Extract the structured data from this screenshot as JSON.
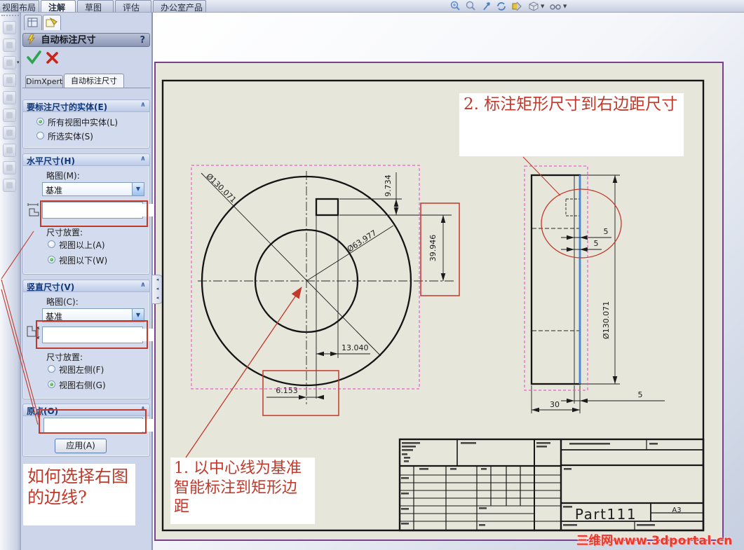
{
  "command_tabs": {
    "items": [
      {
        "label": "视图布局"
      },
      {
        "label": "注解"
      },
      {
        "label": "草图"
      },
      {
        "label": "评估"
      },
      {
        "label": "办公室产品"
      }
    ],
    "active": "注解"
  },
  "heads_up_icons": [
    {
      "name": "zoom-in-icon"
    },
    {
      "name": "zoom-area-icon"
    },
    {
      "name": "pan-icon"
    },
    {
      "name": "rotate-view-icon"
    },
    {
      "name": "section-view-icon"
    },
    {
      "name": "view-orientation-icon"
    },
    {
      "name": "eyeglasses-icon"
    }
  ],
  "property_manager": {
    "header": {
      "title": "自动标注尺寸",
      "help": "?"
    },
    "mode_tabs": {
      "dimxpert": "DimXpert",
      "autodim": "自动标注尺寸"
    },
    "entities_group": {
      "title": "要标注尺寸的实体(E)",
      "radio_all": "所有视图中实体(L)",
      "radio_selected": "所选实体(S)"
    },
    "horizontal_group": {
      "title": "水平尺寸(H)",
      "scheme_label": "略图(M):",
      "scheme_value": "基准",
      "placement_label": "尺寸放置:",
      "radio_above": "视图以上(A)",
      "radio_below": "视图以下(W)"
    },
    "vertical_group": {
      "title": "竖直尺寸(V)",
      "scheme_label": "略图(C):",
      "scheme_value": "基准",
      "placement_label": "尺寸放置:",
      "radio_left": "视图左侧(F)",
      "radio_right": "视图右侧(G)"
    },
    "origin_group": {
      "title": "原点(O)",
      "apply_label": "应用(A)"
    }
  },
  "notes": {
    "note1": "1. 以中心线为基准智能标注到矩形边距",
    "note2": "2. 标注矩形尺寸到右边距尺寸",
    "question": "如何选择右图的边线?"
  },
  "drawing": {
    "front_view": {
      "dia_outer": "Ø130.071",
      "dia_inner": "Ø63.977",
      "keyway_height": "9.734",
      "keyway_to_center": "39.946",
      "keyway_width": "13.040",
      "center_offset": "6.153"
    },
    "side_view": {
      "gap_top": "5",
      "gap_mid": "5",
      "dia": "Ø130.071",
      "width": "30",
      "edge_gap": "5"
    },
    "title_block": {
      "part_name": "Part111",
      "sheet_format": "A3"
    }
  },
  "watermark": "三维网www.3dportal.cn",
  "colors": {
    "annotation_red": "#c0392b",
    "selection_magenta": "#e85fd2",
    "selected_edge_blue": "#3f86e0",
    "swatch_pink": "#f26cb8",
    "swatch_purple": "#7a00d4"
  }
}
